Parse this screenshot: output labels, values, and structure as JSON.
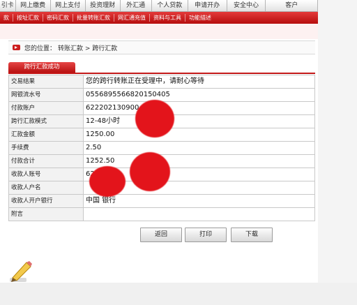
{
  "top_tabs": [
    "引卡",
    "网上缴费",
    "网上支付",
    "投资理财",
    "外汇通",
    "个人贷款",
    "申请开办",
    "安全中心",
    "客户"
  ],
  "sub_nav": [
    "款",
    "按址汇款",
    "密码汇款",
    "批量转账汇款",
    "网汇通充值",
    "资料与工具",
    "功能描述"
  ],
  "breadcrumb": {
    "prefix": "您的位置：",
    "path": "转账汇款 > 跨行汇款"
  },
  "result_tab": "跨行汇款成功",
  "rows": [
    {
      "label": "交易结果",
      "value": "您的跨行转账正在受理中，请耐心等待"
    },
    {
      "label": "网银流水号",
      "value": "0556895566820150405"
    },
    {
      "label": "付款账户",
      "value": "622202130900"
    },
    {
      "label": "跨行汇款模式",
      "value": "12-48小时"
    },
    {
      "label": "汇款金额",
      "value": "1250.00"
    },
    {
      "label": "手续费",
      "value": "2.50"
    },
    {
      "label": "付款合计",
      "value": "1252.50"
    },
    {
      "label": "收款人账号",
      "value": "62"
    },
    {
      "label": "收款人户名",
      "value": ""
    },
    {
      "label": "收款人开户银行",
      "value": "中国      银行"
    },
    {
      "label": "附言",
      "value": ""
    }
  ],
  "buttons": {
    "back": "返回",
    "print": "打印",
    "download": "下载"
  },
  "colors": {
    "brand_red": "#c31818",
    "redaction": "#e3141b"
  },
  "icons": {
    "crumb": "red-arrow-icon",
    "pencil": "pencil-icon"
  }
}
